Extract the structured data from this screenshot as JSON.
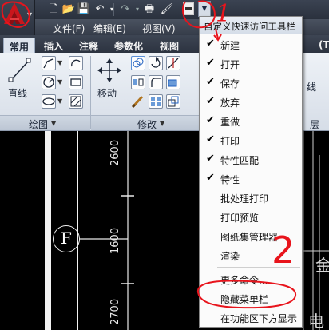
{
  "quick_access": {
    "icons": [
      "new-icon",
      "open-icon",
      "save-icon",
      "undo-icon",
      "redo-icon",
      "print-icon",
      "match-properties-icon",
      "properties-icon"
    ],
    "dropdown_arrow": "▼"
  },
  "menubar": {
    "items": [
      {
        "label": "文件(F)"
      },
      {
        "label": "编辑(E)"
      },
      {
        "label": "视图(V)"
      }
    ]
  },
  "ribbon": {
    "tabs": [
      {
        "label": "常用",
        "active": true
      },
      {
        "label": "插入"
      },
      {
        "label": "注释"
      },
      {
        "label": "参数化"
      },
      {
        "label": "视图"
      }
    ],
    "panels": [
      {
        "title": "绘图",
        "big_button": "直线"
      },
      {
        "title": "修改",
        "big_button": "移动"
      }
    ],
    "partial_labels": [
      "线",
      "层",
      "(T)"
    ]
  },
  "drawing": {
    "dimensions": [
      "2600",
      "1600",
      "2700"
    ],
    "grid_label": "F",
    "partial_text": [
      "金",
      "电"
    ]
  },
  "dropdown_menu": {
    "header": "自定义快速访问工具栏",
    "items": [
      {
        "label": "新建",
        "checked": true
      },
      {
        "label": "打开",
        "checked": true
      },
      {
        "label": "保存",
        "checked": true
      },
      {
        "label": "放弃",
        "checked": true
      },
      {
        "label": "重做",
        "checked": true
      },
      {
        "label": "打印",
        "checked": true
      },
      {
        "label": "特性匹配",
        "checked": true
      },
      {
        "label": "特性",
        "checked": true
      },
      {
        "label": "批处理打印",
        "checked": false
      },
      {
        "label": "打印预览",
        "checked": false
      },
      {
        "label": "图纸集管理器",
        "checked": false
      },
      {
        "label": "渲染",
        "checked": false
      },
      {
        "label": "更多命令...",
        "checked": false
      },
      {
        "label": "隐藏菜单栏",
        "checked": false
      },
      {
        "label": "在功能区下方显示",
        "checked": false
      }
    ]
  },
  "annotations": {
    "step1": "1",
    "step2": "2",
    "color": "#e8141c"
  }
}
